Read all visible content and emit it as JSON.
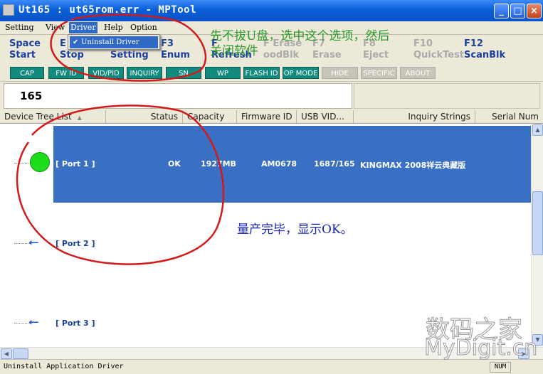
{
  "window": {
    "title": "Ut165 : ut65rom.err  - MPTool",
    "controls": [
      "_",
      "□",
      "×"
    ]
  },
  "menu": {
    "items": [
      "Setting",
      "View",
      "Driver",
      "Help",
      "Option"
    ],
    "active": "Driver",
    "dropdown_item": "Uninstall Driver"
  },
  "funckeys": [
    {
      "key": "Space",
      "label": "Start",
      "enabled": true
    },
    {
      "key": "E",
      "label": "Stop",
      "enabled": true
    },
    {
      "key": "",
      "label": "Setting",
      "enabled": true
    },
    {
      "key": "F3",
      "label": "Enum",
      "enabled": true
    },
    {
      "key": "F",
      "label": "Refresh",
      "enabled": true
    },
    {
      "key": "F Erase",
      "label": "oodBlk",
      "enabled": false
    },
    {
      "key": "F7",
      "label": "Erase",
      "enabled": false
    },
    {
      "key": "F8",
      "label": "Eject",
      "enabled": false
    },
    {
      "key": "F10",
      "label": "QuickTest",
      "enabled": false
    },
    {
      "key": "F12",
      "label": "ScanBlk",
      "enabled": true
    }
  ],
  "buttons": [
    {
      "label": "CAP",
      "enabled": true
    },
    {
      "label": "FW ID",
      "enabled": true
    },
    {
      "label": "VID/PID",
      "enabled": true
    },
    {
      "label": "INQUIRY",
      "enabled": true
    },
    {
      "label": "SN",
      "enabled": true
    },
    {
      "label": "WP",
      "enabled": true
    },
    {
      "label": "FLASH ID",
      "enabled": true
    },
    {
      "label": "OP MODE",
      "enabled": true
    },
    {
      "label": "HIDE INFO",
      "enabled": false
    },
    {
      "label": "SPECIFIC",
      "enabled": false
    },
    {
      "label": "ABOUT",
      "enabled": false
    }
  ],
  "count": "165",
  "columns": [
    "Device Tree List",
    "Status",
    "Capacity",
    "Firmware ID",
    "USB VID...",
    "Inquiry Strings",
    "Serial Num"
  ],
  "ports": [
    {
      "name": "[ Port 1 ]",
      "status": "OK",
      "capacity": "1927MB",
      "firmware": "AM0678",
      "usbvid": "1687/165",
      "inquiry": "KINGMAX  2008祥云典藏版",
      "selected": true
    },
    {
      "name": "[ Port 2 ]"
    },
    {
      "name": "[ Port 3 ]"
    }
  ],
  "status": {
    "text": "Uninstall Application Driver",
    "num": "NUM"
  },
  "annotations": {
    "green_line1": "先不拔U盘，选中这个选项，然后",
    "green_line2": "关闭软件",
    "blue": "量产完毕，显示OK。",
    "watermark_cn": "数码之家",
    "watermark_en": "MyDigit.cn"
  },
  "colors": {
    "titlebar": "#0a5fd8",
    "selected_row": "#3a70c4",
    "toolbar_button": "#128a7e",
    "status_ok_dot": "#1cdc1c",
    "annotation_red": "#d21a1a"
  }
}
